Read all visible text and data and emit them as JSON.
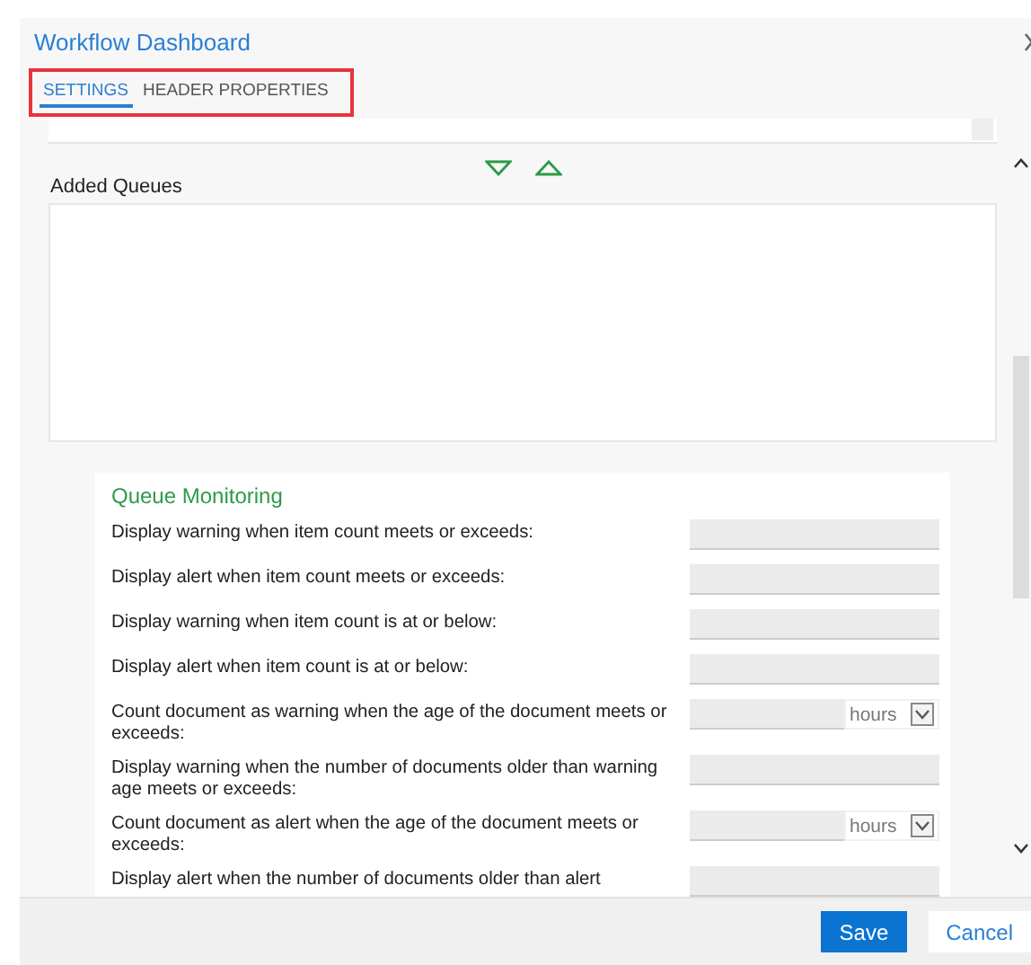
{
  "window": {
    "title": "Workflow Dashboard"
  },
  "tabs": [
    {
      "label": "SETTINGS",
      "selected": true
    },
    {
      "label": "HEADER PROPERTIES",
      "selected": false
    }
  ],
  "added_queues": {
    "label": "Added Queues"
  },
  "queue_monitoring": {
    "title": "Queue Monitoring",
    "rows": [
      {
        "kind": "number",
        "label": "Display warning when item count meets or exceeds:"
      },
      {
        "kind": "number",
        "label": "Display alert when item count meets or exceeds:"
      },
      {
        "kind": "number",
        "label": "Display warning when item count is at or below:"
      },
      {
        "kind": "number",
        "label": "Display alert when item count is at or below:"
      },
      {
        "kind": "number_unit",
        "label": "Count document as warning when the age of the document meets or exceeds:",
        "unit": "hours"
      },
      {
        "kind": "number",
        "label": "Display warning when the number of documents older than warning age meets or exceeds:"
      },
      {
        "kind": "number_unit",
        "label": "Count document as alert when the age of the document meets or exceeds:",
        "unit": "hours"
      },
      {
        "kind": "number",
        "label": "Display alert when the number of documents older than alert"
      }
    ]
  },
  "buttons": [
    {
      "label": "Save",
      "kind": "primary"
    },
    {
      "label": "Cancel",
      "kind": "secondary"
    }
  ]
}
